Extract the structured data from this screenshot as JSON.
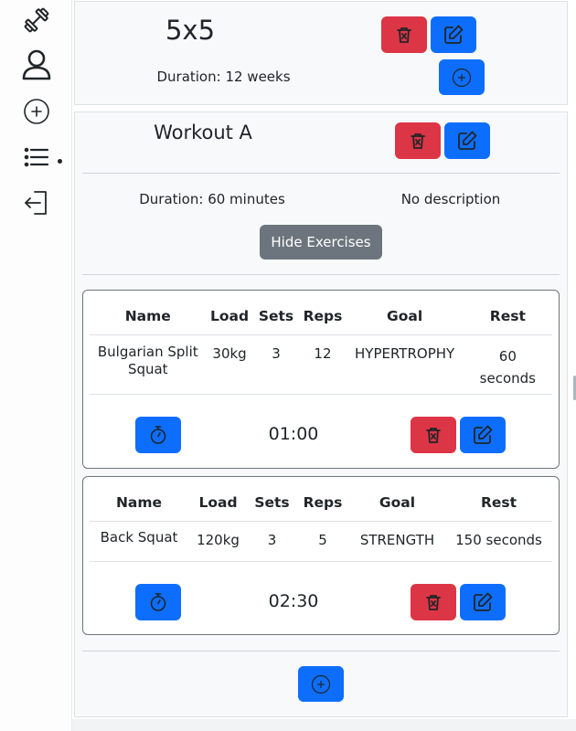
{
  "sidebar": {
    "items": [
      {
        "icon": "dumbbell-icon"
      },
      {
        "icon": "user-icon"
      },
      {
        "icon": "add-circle-icon"
      },
      {
        "icon": "list-icon"
      },
      {
        "icon": "logout-icon"
      }
    ]
  },
  "program": {
    "title": "5x5",
    "duration": "Duration: 12 weeks"
  },
  "workout": {
    "title": "Workout A",
    "duration": "Duration: 60 minutes",
    "description": "No description",
    "toggle_label": "Hide Exercises"
  },
  "table_headers": [
    "Name",
    "Load",
    "Sets",
    "Reps",
    "Goal",
    "Rest"
  ],
  "exercises": [
    {
      "name": "Bulgarian Split Squat",
      "load": "30kg",
      "sets": "3",
      "reps": "12",
      "goal": "HYPERTROPHY",
      "rest": "60 seconds",
      "timer": "01:00"
    },
    {
      "name": "Back Squat",
      "load": "120kg",
      "sets": "3",
      "reps": "5",
      "goal": "STRENGTH",
      "rest": "150 seconds",
      "timer": "02:30"
    }
  ],
  "colors": {
    "danger": "#dc3545",
    "primary": "#0d6efd",
    "secondary": "#6c757d"
  }
}
